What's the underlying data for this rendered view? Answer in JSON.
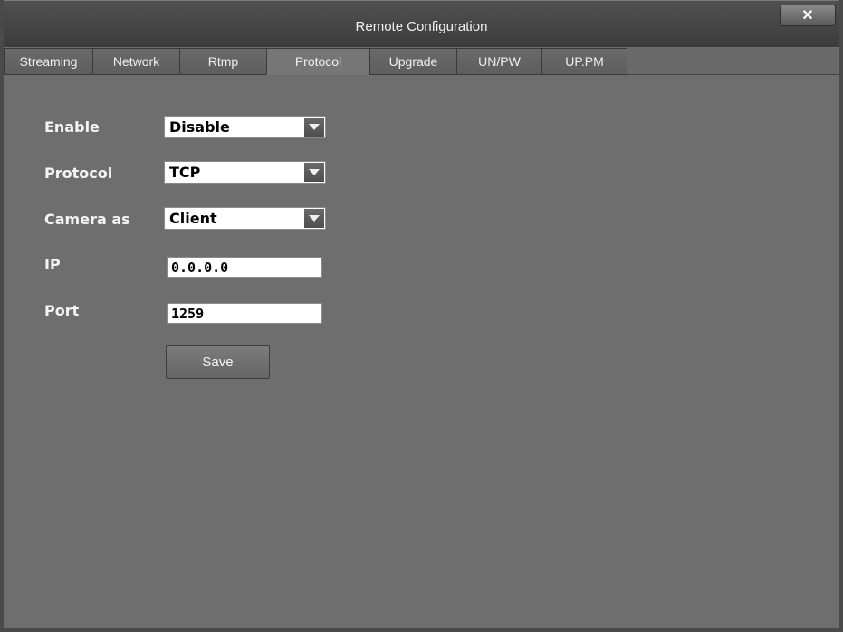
{
  "window": {
    "title": "Remote Configuration",
    "close_label": "✕"
  },
  "tabs": [
    {
      "label": "Streaming"
    },
    {
      "label": "Network"
    },
    {
      "label": "Rtmp"
    },
    {
      "label": "Protocol"
    },
    {
      "label": "Upgrade"
    },
    {
      "label": "UN/PW"
    },
    {
      "label": "UP.PM"
    }
  ],
  "active_tab": "Protocol",
  "form": {
    "enable": {
      "label": "Enable",
      "value": "Disable"
    },
    "protocol": {
      "label": "Protocol",
      "value": "TCP"
    },
    "camera_as": {
      "label": "Camera as",
      "value": "Client"
    },
    "ip": {
      "label": "IP",
      "value": "0.0.0.0"
    },
    "port": {
      "label": "Port",
      "value": "1259"
    },
    "save_label": "Save"
  }
}
